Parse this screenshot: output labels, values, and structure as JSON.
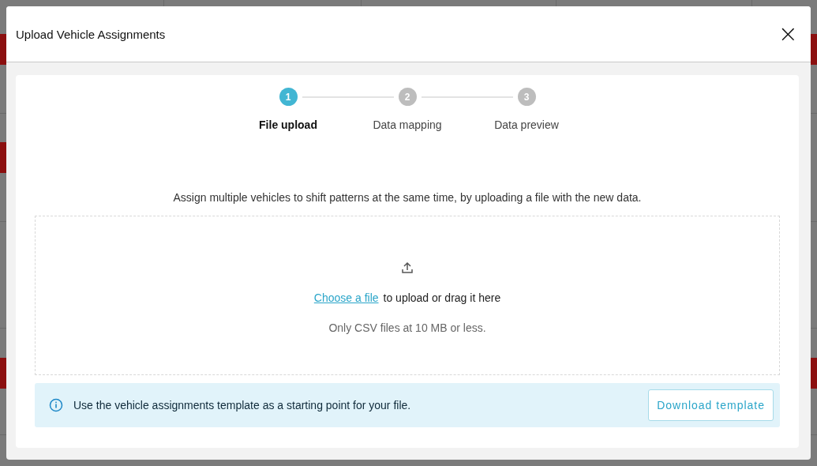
{
  "dialog": {
    "title": "Upload Vehicle Assignments",
    "close": "×",
    "steps": [
      {
        "number": "1",
        "label": "File upload",
        "selected": true
      },
      {
        "number": "2",
        "label": "Data mapping",
        "selected": false
      },
      {
        "number": "3",
        "label": "Data preview",
        "selected": false
      }
    ],
    "intro": "Assign multiple vehicles to shift patterns at the same time, by uploading a file with the new data.",
    "dropzone": {
      "link": "Choose a file",
      "text": "to upload or drag it here",
      "hint": "Only CSV files at 10 MB or less."
    },
    "info": {
      "text": "Use the vehicle assignments template as a starting point for your file.",
      "button": "Download template"
    }
  }
}
